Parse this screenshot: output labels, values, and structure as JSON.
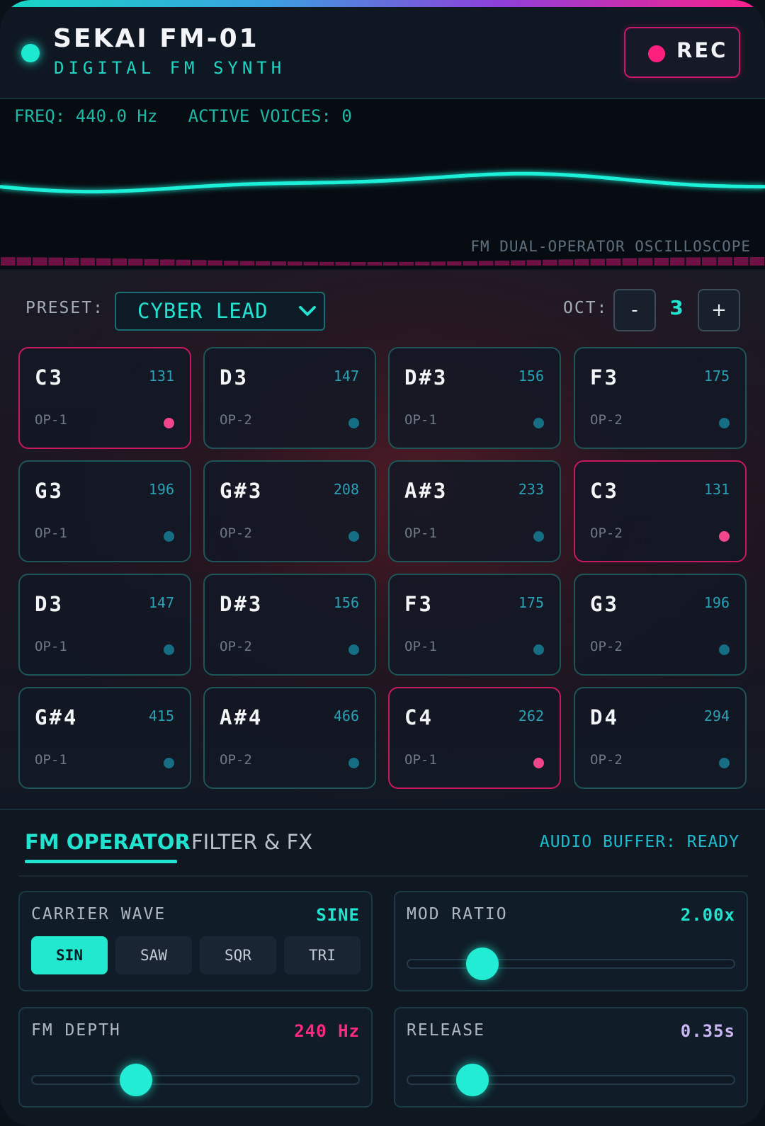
{
  "header": {
    "title": "SEKAI FM-01",
    "subtitle": "DIGITAL FM SYNTH",
    "rec_label": "REC"
  },
  "scope": {
    "freq_readout": "FREQ: 440.0 Hz",
    "voices_readout": "ACTIVE VOICES: 0",
    "caption": "FM DUAL-OPERATOR OSCILLOSCOPE"
  },
  "preset": {
    "label": "PRESET:",
    "value": "CYBER LEAD"
  },
  "octave": {
    "label": "OCT:",
    "decrement": "-",
    "value": "3",
    "increment": "+"
  },
  "pads": [
    {
      "note": "C3",
      "freq": "131",
      "op": "OP-1",
      "active": true
    },
    {
      "note": "D3",
      "freq": "147",
      "op": "OP-2",
      "active": false
    },
    {
      "note": "D#3",
      "freq": "156",
      "op": "OP-1",
      "active": false
    },
    {
      "note": "F3",
      "freq": "175",
      "op": "OP-2",
      "active": false
    },
    {
      "note": "G3",
      "freq": "196",
      "op": "OP-1",
      "active": false
    },
    {
      "note": "G#3",
      "freq": "208",
      "op": "OP-2",
      "active": false
    },
    {
      "note": "A#3",
      "freq": "233",
      "op": "OP-1",
      "active": false
    },
    {
      "note": "C3",
      "freq": "131",
      "op": "OP-2",
      "active": true
    },
    {
      "note": "D3",
      "freq": "147",
      "op": "OP-1",
      "active": false
    },
    {
      "note": "D#3",
      "freq": "156",
      "op": "OP-2",
      "active": false
    },
    {
      "note": "F3",
      "freq": "175",
      "op": "OP-1",
      "active": false
    },
    {
      "note": "G3",
      "freq": "196",
      "op": "OP-2",
      "active": false
    },
    {
      "note": "G#4",
      "freq": "415",
      "op": "OP-1",
      "active": false
    },
    {
      "note": "A#4",
      "freq": "466",
      "op": "OP-2",
      "active": false
    },
    {
      "note": "C4",
      "freq": "262",
      "op": "OP-1",
      "active": true
    },
    {
      "note": "D4",
      "freq": "294",
      "op": "OP-2",
      "active": false
    }
  ],
  "tabs": {
    "fm_operator": "FM OPERATOR",
    "filter_fx": "FILTER & FX",
    "buffer_status": "AUDIO BUFFER: READY"
  },
  "carrier": {
    "label": "CARRIER WAVE",
    "value": "SINE",
    "options": [
      "SIN",
      "SAW",
      "SQR",
      "TRI"
    ],
    "selected": 0
  },
  "mod_ratio": {
    "label": "MOD RATIO",
    "value": "2.00x",
    "level": 0.23
  },
  "fm_depth": {
    "label": "FM DEPTH",
    "value": "240 Hz",
    "level": 0.32
  },
  "release": {
    "label": "RELEASE",
    "value": "0.35s",
    "level": 0.2
  },
  "colors": {
    "accent": "#21e3cf",
    "alert": "#ff1f7f",
    "fm_depth_value": "#ff2a7f",
    "release_value": "#c9b6f2"
  }
}
